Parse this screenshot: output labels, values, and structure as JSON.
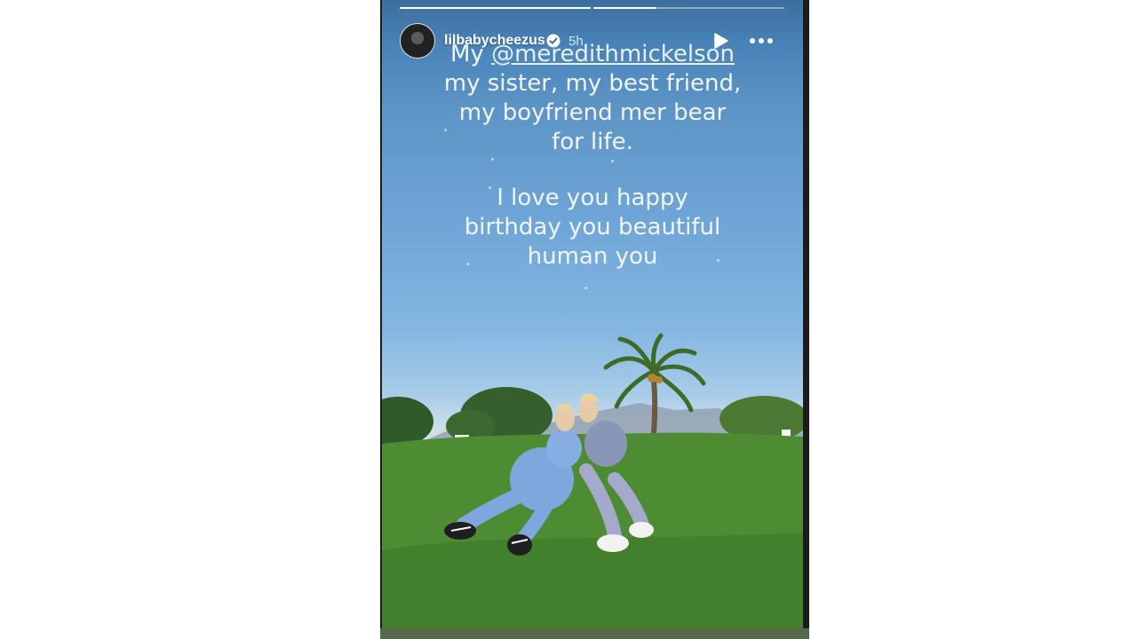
{
  "story": {
    "username": "lilbabycheezus",
    "time": "5h",
    "progress": [
      1.0,
      0.33
    ],
    "caption_lines_1": [
      "My @meredithmickelson",
      "my sister, my best friend,",
      "my boyfriend mer bear",
      "for life."
    ],
    "caption_mention": "@meredithmickelson",
    "caption_prefix": "My ",
    "caption_line_2": "my sister, my best friend,",
    "caption_line_3": "my boyfriend mer bear",
    "caption_line_4": "for life.",
    "caption_line_5": "I love you happy",
    "caption_line_6": "birthday you beautiful",
    "caption_line_7": "human you"
  },
  "icons": {
    "avatar": "profile-photo",
    "verified": "verified-badge-icon",
    "play": "play-icon",
    "more": "more-horizontal-icon"
  },
  "colors": {
    "sky_top": "#3d6f9d",
    "grass": "#4f8c34",
    "outfit": "#7fa7de"
  }
}
